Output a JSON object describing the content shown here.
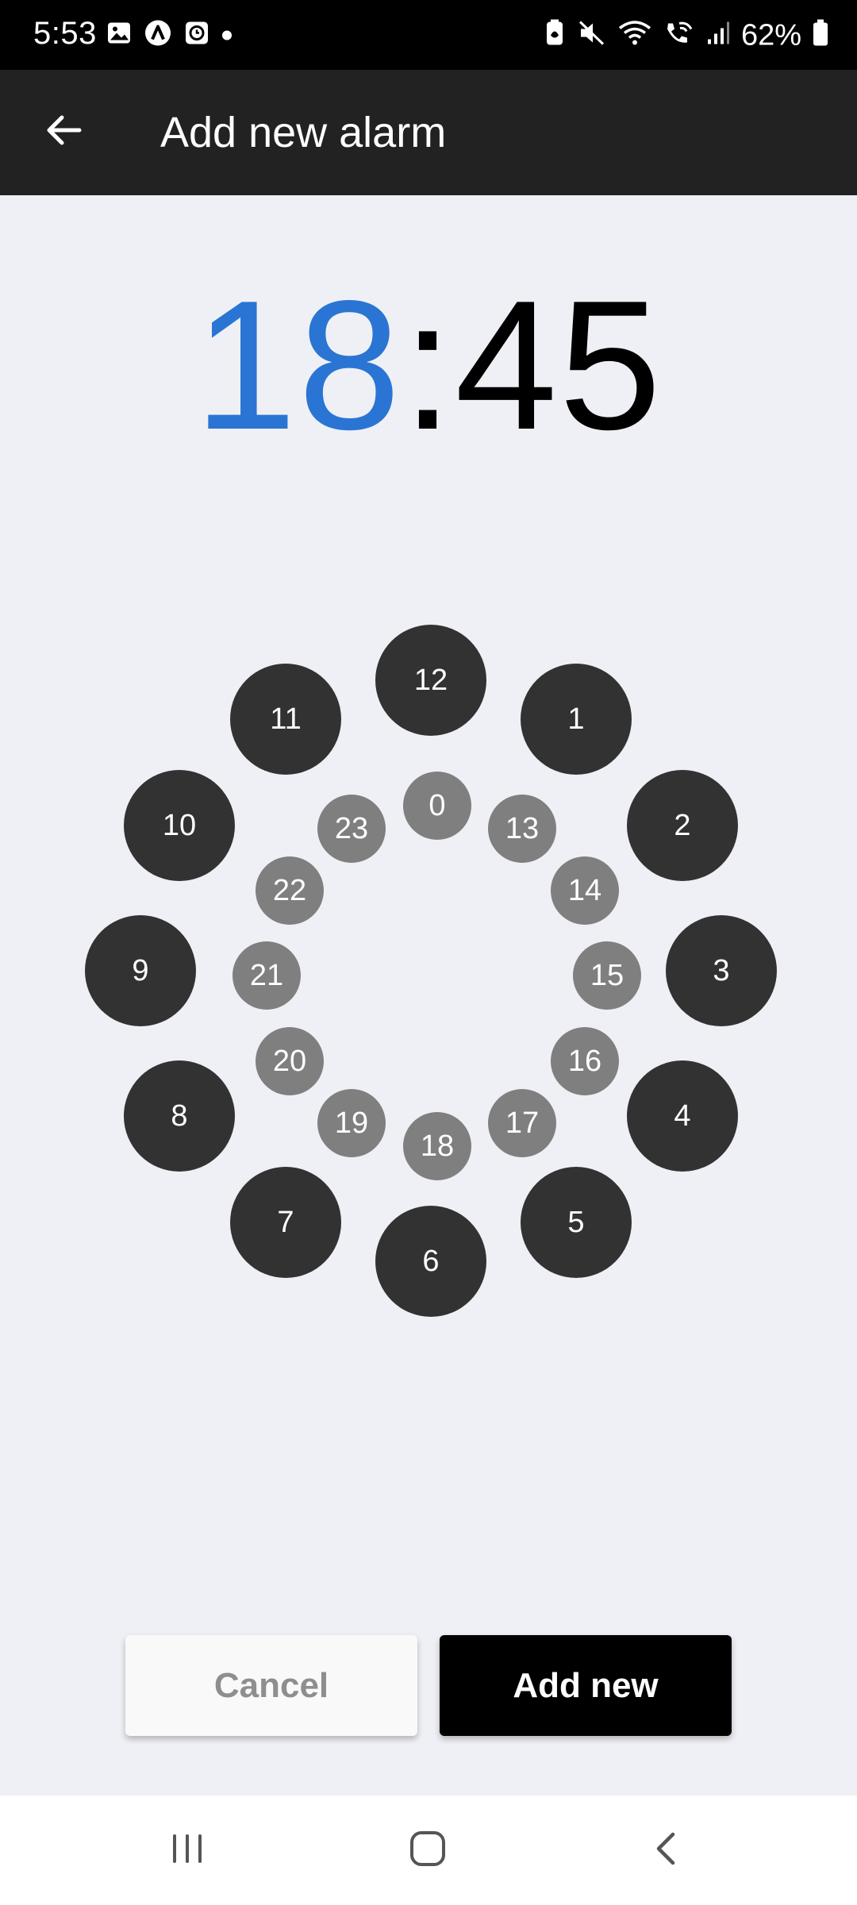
{
  "status_bar": {
    "time": "5:53",
    "battery": "62%",
    "left_icons": [
      "gallery-icon",
      "app-a-icon",
      "alarm-clock-icon",
      "notification-dot-icon"
    ],
    "right_icons": [
      "battery-saver-icon",
      "mute-icon",
      "wifi-icon",
      "wifi-calling-icon",
      "signal-icon",
      "battery-icon"
    ]
  },
  "app_bar": {
    "title": "Add new alarm",
    "back_icon": "arrow-back-icon"
  },
  "time": {
    "hour": "18",
    "separator": ":",
    "minute": "45",
    "hour_color": "#2a75d3"
  },
  "dial": {
    "outer_hours": [
      "12",
      "1",
      "2",
      "3",
      "4",
      "5",
      "6",
      "7",
      "8",
      "9",
      "10",
      "11"
    ],
    "inner_hours": [
      "0",
      "13",
      "14",
      "15",
      "16",
      "17",
      "18",
      "19",
      "20",
      "21",
      "22",
      "23"
    ],
    "outer_color": "#323232",
    "inner_color": "#7f7f7f"
  },
  "actions": {
    "cancel_label": "Cancel",
    "add_label": "Add new"
  },
  "nav": {
    "recents_icon": "recents-icon",
    "home_icon": "home-icon",
    "back_icon": "back-chevron-icon"
  }
}
